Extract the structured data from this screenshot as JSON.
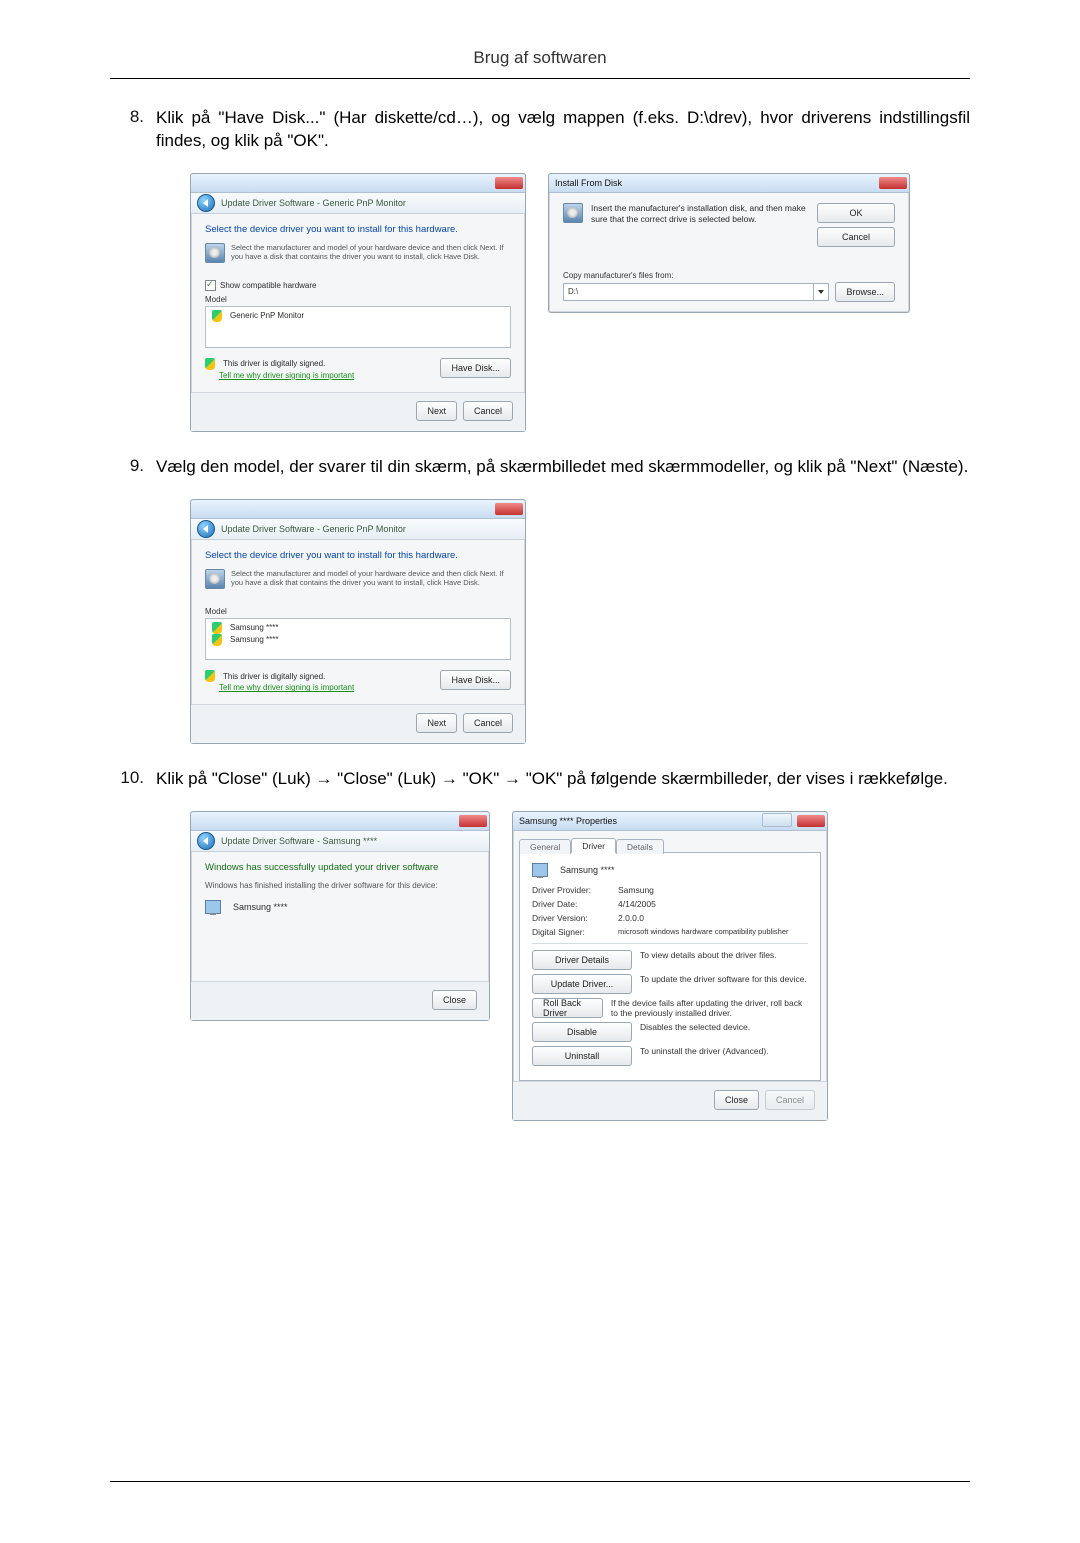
{
  "page": {
    "header": "Brug af softwaren"
  },
  "steps": {
    "s8": {
      "num": "8.",
      "text": "Klik på \"Have Disk...\" (Har diskette/cd…), og vælg mappen (f.eks. D:\\drev), hvor driverens indstillingsfil findes, og klik på \"OK\"."
    },
    "s9": {
      "num": "9.",
      "text": "Vælg den model, der svarer til din skærm, på skærmbilledet med skærmmodeller, og klik på \"Next\" (Næste)."
    },
    "s10": {
      "num": "10.",
      "text": "Klik på \"Close\" (Luk) → \"Close\" (Luk) → \"OK\" → \"OK\" på følgende skærmbilleder, der vises i rækkefølge."
    }
  },
  "dlg_update1": {
    "breadcrumb": "Update Driver Software - Generic PnP Monitor",
    "heading": "Select the device driver you want to install for this hardware.",
    "note": "Select the manufacturer and model of your hardware device and then click Next. If you have a disk that contains the driver you want to install, click Have Disk.",
    "compat_checkbox": "Show compatible hardware",
    "model_label": "Model",
    "model_item": "Generic PnP Monitor",
    "signed": "This driver is digitally signed.",
    "signed_link": "Tell me why driver signing is important",
    "have_disk": "Have Disk...",
    "next": "Next",
    "cancel": "Cancel"
  },
  "dlg_install_from_disk": {
    "title": "Install From Disk",
    "instr": "Insert the manufacturer's installation disk, and then make sure that the correct drive is selected below.",
    "ok": "OK",
    "cancel": "Cancel",
    "copy_label": "Copy manufacturer's files from:",
    "path": "D:\\",
    "browse": "Browse..."
  },
  "dlg_update2": {
    "breadcrumb": "Update Driver Software - Generic PnP Monitor",
    "heading": "Select the device driver you want to install for this hardware.",
    "note": "Select the manufacturer and model of your hardware device and then click Next. If you have a disk that contains the driver you want to install, click Have Disk.",
    "model_label": "Model",
    "model_item1": "Samsung ****",
    "model_item2": "Samsung ****",
    "signed": "This driver is digitally signed.",
    "signed_link": "Tell me why driver signing is important",
    "have_disk": "Have Disk...",
    "next": "Next",
    "cancel": "Cancel"
  },
  "dlg_success": {
    "breadcrumb": "Update Driver Software - Samsung ****",
    "heading": "Windows has successfully updated your driver software",
    "sub": "Windows has finished installing the driver software for this device:",
    "device": "Samsung ****",
    "close": "Close"
  },
  "dlg_props": {
    "title": "Samsung **** Properties",
    "tab_general": "General",
    "tab_driver": "Driver",
    "tab_details": "Details",
    "device": "Samsung ****",
    "rows": {
      "provider_l": "Driver Provider:",
      "provider_v": "Samsung",
      "date_l": "Driver Date:",
      "date_v": "4/14/2005",
      "version_l": "Driver Version:",
      "version_v": "2.0.0.0",
      "signer_l": "Digital Signer:",
      "signer_v": "microsoft windows hardware compatibility publisher"
    },
    "btn_details": "Driver Details",
    "btn_details_d": "To view details about the driver files.",
    "btn_update": "Update Driver...",
    "btn_update_d": "To update the driver software for this device.",
    "btn_rollback": "Roll Back Driver",
    "btn_rollback_d": "If the device fails after updating the driver, roll back to the previously installed driver.",
    "btn_disable": "Disable",
    "btn_disable_d": "Disables the selected device.",
    "btn_uninstall": "Uninstall",
    "btn_uninstall_d": "To uninstall the driver (Advanced).",
    "close": "Close",
    "cancel": "Cancel"
  }
}
